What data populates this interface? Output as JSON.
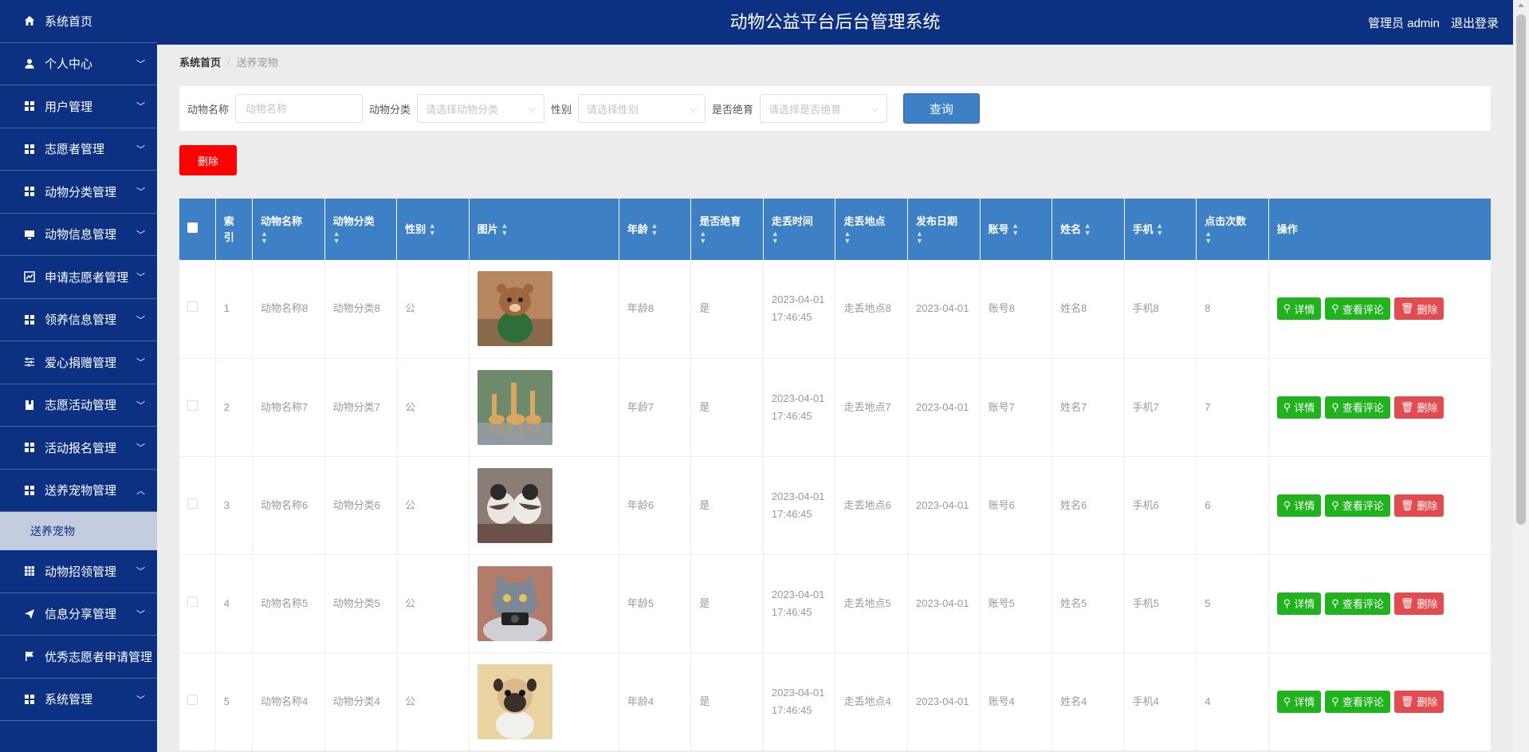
{
  "app_title": "动物公益平台后台管理系统",
  "header": {
    "admin_label": "管理员 admin",
    "logout_label": "退出登录"
  },
  "sidebar": {
    "items": [
      {
        "label": "系统首页",
        "icon": "home-icon"
      },
      {
        "label": "个人中心",
        "icon": "user-icon"
      },
      {
        "label": "用户管理",
        "icon": "grid-icon"
      },
      {
        "label": "志愿者管理",
        "icon": "grid-icon"
      },
      {
        "label": "动物分类管理",
        "icon": "grid-icon"
      },
      {
        "label": "动物信息管理",
        "icon": "monitor-icon"
      },
      {
        "label": "申请志愿者管理",
        "icon": "chart-icon"
      },
      {
        "label": "领养信息管理",
        "icon": "grid-icon"
      },
      {
        "label": "爱心捐赠管理",
        "icon": "sliders-icon"
      },
      {
        "label": "志愿活动管理",
        "icon": "book-icon"
      },
      {
        "label": "活动报名管理",
        "icon": "grid-icon"
      },
      {
        "label": "送养宠物管理",
        "icon": "grid-icon",
        "expanded": true
      },
      {
        "label": "动物招领管理",
        "icon": "table-icon"
      },
      {
        "label": "信息分享管理",
        "icon": "send-icon"
      },
      {
        "label": "优秀志愿者申请管理",
        "icon": "flag-icon"
      },
      {
        "label": "系统管理",
        "icon": "grid-icon"
      }
    ],
    "submenu": {
      "label": "送养宠物"
    }
  },
  "breadcrumb": {
    "home": "系统首页",
    "current": "送养宠物"
  },
  "search": {
    "name_label": "动物名称",
    "name_placeholder": "动物名称",
    "category_label": "动物分类",
    "category_placeholder": "请选择动物分类",
    "gender_label": "性别",
    "gender_placeholder": "请选择性别",
    "sterilized_label": "是否绝育",
    "sterilized_placeholder": "请选择是否绝育",
    "query_button": "查询"
  },
  "delete_button": "删除",
  "table": {
    "headers": {
      "index": "索引",
      "name": "动物名称",
      "category": "动物分类",
      "gender": "性别",
      "image": "图片",
      "age": "年龄",
      "sterilized": "是否绝育",
      "lost_time": "走丢时间",
      "lost_place": "走丢地点",
      "publish_date": "发布日期",
      "account": "账号",
      "person": "姓名",
      "phone": "手机",
      "clicks": "点击次数",
      "actions": "操作"
    },
    "actions": {
      "detail": "详情",
      "comments": "查看评论",
      "delete": "删除"
    },
    "rows": [
      {
        "index": "1",
        "name": "动物名称8",
        "category": "动物分类8",
        "gender": "公",
        "image": "hamster",
        "age": "年龄8",
        "sterilized": "是",
        "lost_time": "2023-04-01 17:46:45",
        "lost_place": "走丢地点8",
        "publish_date": "2023-04-01",
        "account": "账号8",
        "person": "姓名8",
        "phone": "手机8",
        "clicks": "8"
      },
      {
        "index": "2",
        "name": "动物名称7",
        "category": "动物分类7",
        "gender": "公",
        "image": "giraffes",
        "age": "年龄7",
        "sterilized": "是",
        "lost_time": "2023-04-01 17:46:45",
        "lost_place": "走丢地点7",
        "publish_date": "2023-04-01",
        "account": "账号7",
        "person": "姓名7",
        "phone": "手机7",
        "clicks": "7"
      },
      {
        "index": "3",
        "name": "动物名称6",
        "category": "动物分类6",
        "gender": "公",
        "image": "birds",
        "age": "年龄6",
        "sterilized": "是",
        "lost_time": "2023-04-01 17:46:45",
        "lost_place": "走丢地点6",
        "publish_date": "2023-04-01",
        "account": "账号6",
        "person": "姓名6",
        "phone": "手机6",
        "clicks": "6"
      },
      {
        "index": "4",
        "name": "动物名称5",
        "category": "动物分类5",
        "gender": "公",
        "image": "cat",
        "age": "年龄5",
        "sterilized": "是",
        "lost_time": "2023-04-01 17:46:45",
        "lost_place": "走丢地点5",
        "publish_date": "2023-04-01",
        "account": "账号5",
        "person": "姓名5",
        "phone": "手机5",
        "clicks": "5"
      },
      {
        "index": "5",
        "name": "动物名称4",
        "category": "动物分类4",
        "gender": "公",
        "image": "pug",
        "age": "年龄4",
        "sterilized": "是",
        "lost_time": "2023-04-01 17:46:45",
        "lost_place": "走丢地点4",
        "publish_date": "2023-04-01",
        "account": "账号4",
        "person": "姓名4",
        "phone": "手机4",
        "clicks": "4"
      }
    ]
  }
}
